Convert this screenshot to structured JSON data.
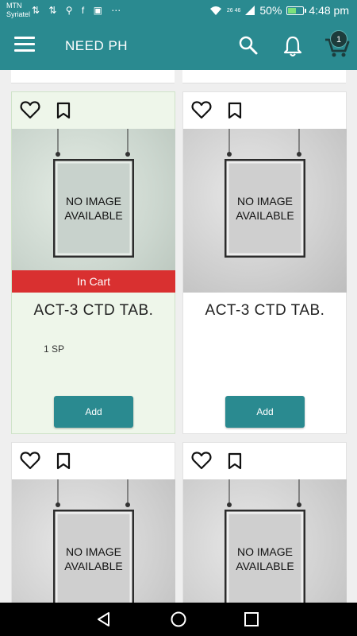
{
  "status_bar": {
    "carrier_1": "MTN",
    "carrier_2": "Syriatel",
    "left_icons": "⇅ ⇅ ⚲ f ▣ ⋯",
    "network": "26 46",
    "battery": "50%",
    "time": "4:48 pm"
  },
  "app_bar": {
    "title": "NEED PH",
    "cart_count": "1"
  },
  "products": [
    {
      "no_image_line1": "NO IMAGE",
      "no_image_line2": "AVAILABLE",
      "cart_label": "In Cart",
      "name": "ACT-3 CTD TAB.",
      "price": "1 SP",
      "add_label": "Add"
    },
    {
      "no_image_line1": "NO IMAGE",
      "no_image_line2": "AVAILABLE",
      "name": "ACT-3 CTD TAB.",
      "add_label": "Add"
    },
    {
      "no_image_line1": "NO IMAGE",
      "no_image_line2": "AVAILABLE"
    },
    {
      "no_image_line1": "NO IMAGE",
      "no_image_line2": "AVAILABLE"
    }
  ],
  "colors": {
    "primary": "#2a8a90",
    "in_cart": "#d93030",
    "in_cart_card_bg": "#eef6ea",
    "nav_bar": "#000000"
  },
  "icons": [
    "menu-icon",
    "search-icon",
    "bell-icon",
    "cart-icon",
    "heart-icon",
    "bookmark-icon",
    "back-icon",
    "home-icon",
    "recents-icon"
  ]
}
